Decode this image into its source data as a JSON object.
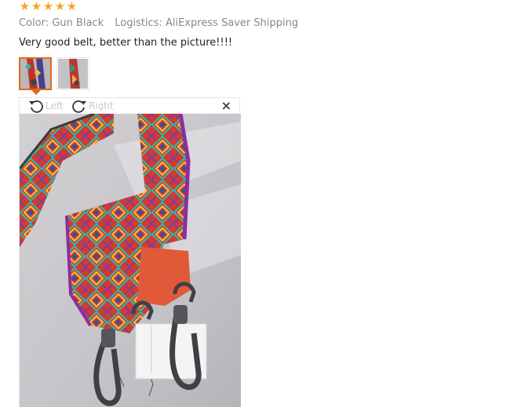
{
  "review": {
    "rating": 5,
    "stars": [
      "★",
      "★",
      "★",
      "★",
      "★"
    ],
    "color_label": "Color:",
    "color_value": "Gun Black",
    "logistics_label": "Logistics:",
    "logistics_value": "AliExpress Saver Shipping",
    "text": "Very good belt, better than the picture!!!!"
  },
  "thumbnails": [
    {
      "name": "thumbnail-1",
      "selected": true
    },
    {
      "name": "thumbnail-2",
      "selected": false
    }
  ],
  "viewer": {
    "rotate_left_label": "Left",
    "rotate_right_label": "Right",
    "close_symbol": "×",
    "icons": {
      "rotate_left": "rotate-left-icon",
      "rotate_right": "rotate-right-icon",
      "close": "close-icon"
    }
  },
  "colors": {
    "star": "#f5a623",
    "selected_border": "#e36a1c",
    "muted_text": "#888888"
  }
}
